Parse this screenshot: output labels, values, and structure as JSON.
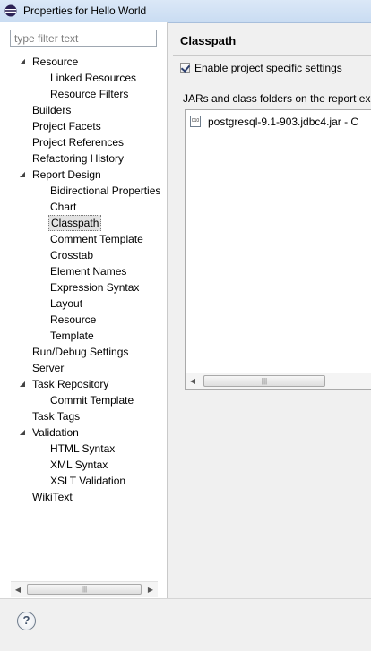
{
  "window": {
    "title": "Properties for Hello World",
    "icon": "eclipse-icon"
  },
  "filter": {
    "placeholder": "type filter text",
    "value": ""
  },
  "tree": [
    {
      "label": "Resource",
      "level": 0,
      "expand": "expanded"
    },
    {
      "label": "Linked Resources",
      "level": 1
    },
    {
      "label": "Resource Filters",
      "level": 1
    },
    {
      "label": "Builders",
      "level": 0
    },
    {
      "label": "Project Facets",
      "level": 0
    },
    {
      "label": "Project References",
      "level": 0
    },
    {
      "label": "Refactoring History",
      "level": 0
    },
    {
      "label": "Report Design",
      "level": 0,
      "expand": "expanded"
    },
    {
      "label": "Bidirectional Properties",
      "level": 1
    },
    {
      "label": "Chart",
      "level": 1
    },
    {
      "label": "Classpath",
      "level": 1,
      "selected": true
    },
    {
      "label": "Comment Template",
      "level": 1
    },
    {
      "label": "Crosstab",
      "level": 1
    },
    {
      "label": "Element Names",
      "level": 1
    },
    {
      "label": "Expression Syntax",
      "level": 1
    },
    {
      "label": "Layout",
      "level": 1
    },
    {
      "label": "Resource",
      "level": 1
    },
    {
      "label": "Template",
      "level": 1
    },
    {
      "label": "Run/Debug Settings",
      "level": 0
    },
    {
      "label": "Server",
      "level": 0
    },
    {
      "label": "Task Repository",
      "level": 0,
      "expand": "expanded"
    },
    {
      "label": "Commit Template",
      "level": 1
    },
    {
      "label": "Task Tags",
      "level": 0
    },
    {
      "label": "Validation",
      "level": 0,
      "expand": "expanded"
    },
    {
      "label": "HTML Syntax",
      "level": 1
    },
    {
      "label": "XML Syntax",
      "level": 1
    },
    {
      "label": "XSLT Validation",
      "level": 1
    },
    {
      "label": "WikiText",
      "level": 0
    }
  ],
  "page": {
    "title": "Classpath",
    "enable_checkbox": {
      "label": "Enable project specific settings",
      "checked": true
    },
    "jars_label": "JARs and class folders on the report exec",
    "jars": [
      {
        "name": "postgresql-9.1-903.jdbc4.jar - C",
        "icon": "jar-file-icon"
      }
    ]
  },
  "icons": {
    "expanded_arrow": "◢",
    "scroll_left": "◀",
    "scroll_right": "▶",
    "grip": "|||",
    "help": "?"
  }
}
